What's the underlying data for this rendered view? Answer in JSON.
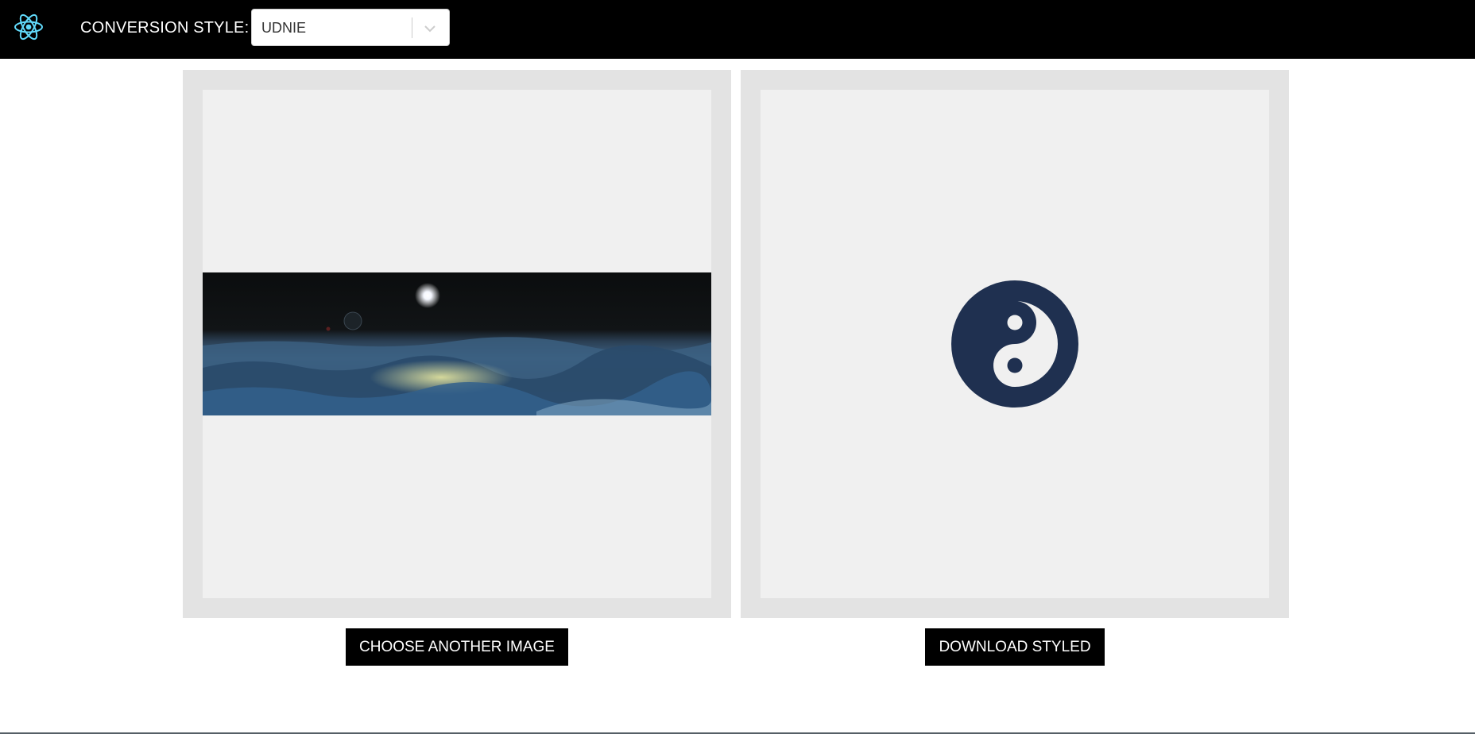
{
  "header": {
    "logo_icon": "react-atom-icon",
    "conversion_label": "CONVERSION STYLE:",
    "style_select": {
      "value": "UDNIE",
      "arrow_icon": "chevron-down-icon"
    }
  },
  "main": {
    "input_panel": {
      "image": "space-landscape-image"
    },
    "output_panel": {
      "placeholder_icon": "yin-yang-icon"
    }
  },
  "actions": {
    "choose_label": "CHOOSE ANOTHER IMAGE",
    "download_label": "DOWNLOAD STYLED"
  },
  "colors": {
    "topbar": "#000000",
    "react_logo": "#61dafb",
    "panel_outer": "#e3e3e3",
    "panel_inner": "#f0f0f0",
    "yin_yang": "#1f3050",
    "button_bg": "#000000"
  }
}
